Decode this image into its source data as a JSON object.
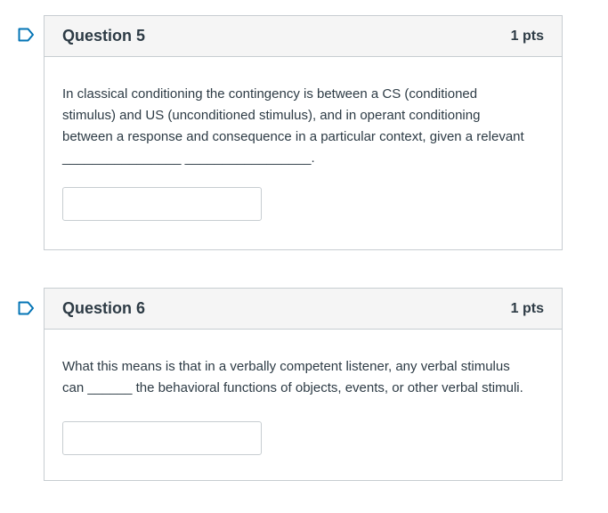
{
  "questions": [
    {
      "title": "Question 5",
      "points": "1 pts",
      "text_lines": [
        "In classical conditioning the contingency is between a CS (conditioned",
        "stimulus) and US (unconditioned stimulus), and in operant conditioning",
        "between a response and consequence in a particular context, given a relevant",
        "________________ _________________."
      ],
      "answer_value": "",
      "flag_icon": "bookmark-flag-icon"
    },
    {
      "title": "Question 6",
      "points": "1 pts",
      "text_lines": [
        "What this means is that in a verbally competent listener, any verbal stimulus",
        "can ______ the behavioral functions of objects, events, or other verbal stimuli."
      ],
      "answer_value": "",
      "flag_icon": "bookmark-flag-icon"
    }
  ],
  "colors": {
    "flag": "#0374b5",
    "border": "#c7cdd1",
    "header_bg": "#f5f5f5",
    "text": "#2d3b45"
  }
}
